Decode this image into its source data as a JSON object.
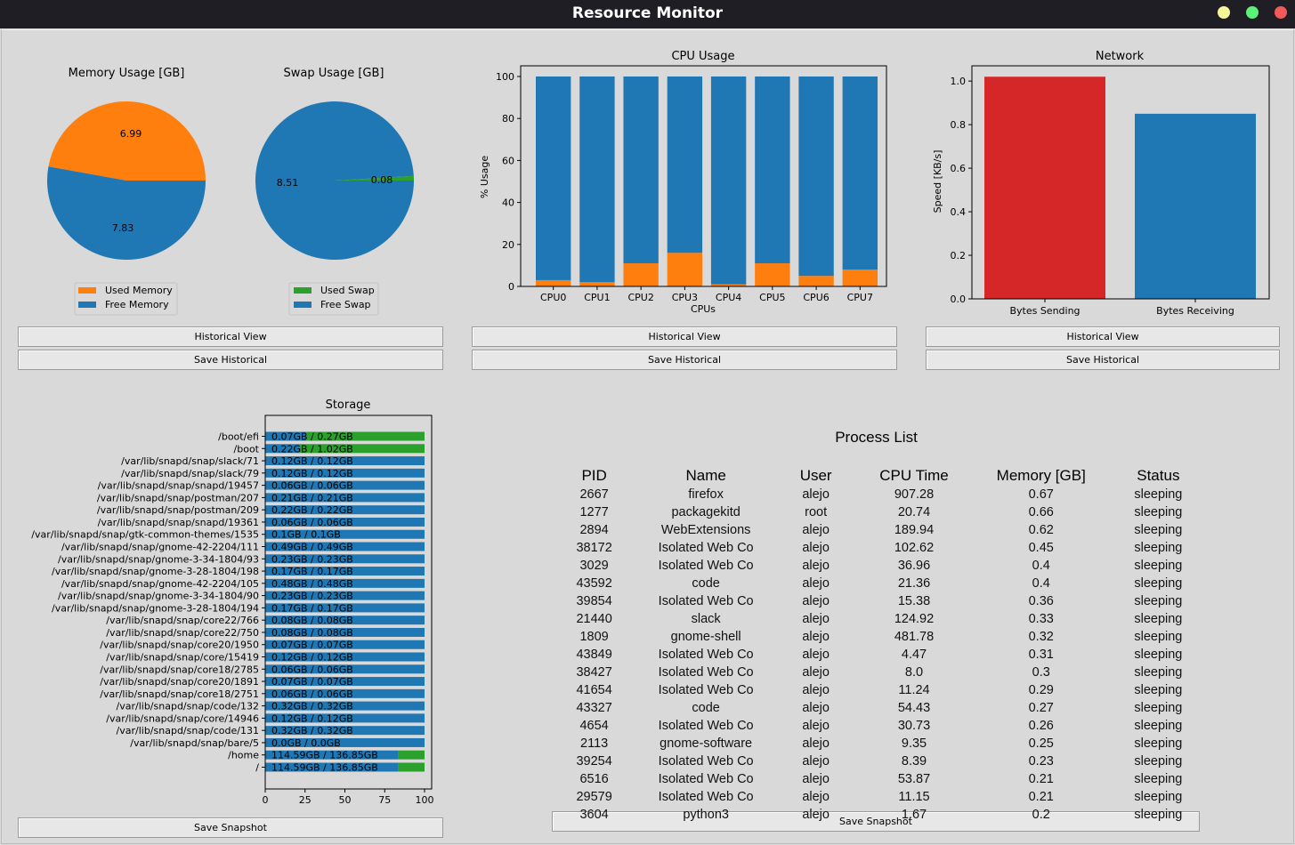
{
  "window": {
    "title": "Resource Monitor"
  },
  "memory": {
    "title": "Memory Usage [GB]",
    "used": 6.99,
    "free": 7.83,
    "used_label": "6.99",
    "free_label": "7.83",
    "legend_used": "Used Memory",
    "legend_free": "Free Memory"
  },
  "swap": {
    "title": "Swap Usage [GB]",
    "used": 0.08,
    "free": 8.51,
    "used_label": "0.08",
    "free_label": "8.51",
    "legend_used": "Used Swap",
    "legend_free": "Free Swap"
  },
  "colors": {
    "used": "#ff7f0e",
    "free": "#1f77b4",
    "swap_used": "#2ca02c",
    "sending": "#d62728",
    "receiving": "#1f77b4"
  },
  "chart_data": [
    {
      "type": "bar",
      "title": "CPU Usage",
      "xlabel": "CPUs",
      "ylabel": "% Usage",
      "categories": [
        "CPU0",
        "CPU1",
        "CPU2",
        "CPU3",
        "CPU4",
        "CPU5",
        "CPU6",
        "CPU7"
      ],
      "series": [
        {
          "values": [
            3,
            2,
            11,
            16,
            1,
            11,
            5,
            8
          ]
        },
        {
          "values": [
            97,
            98,
            89,
            84,
            99,
            89,
            95,
            92
          ]
        }
      ],
      "ylim": [
        0,
        100
      ],
      "yticks": [
        "0",
        "20",
        "40",
        "60",
        "80",
        "100"
      ]
    },
    {
      "type": "bar",
      "title": "Network",
      "ylabel": "Speed [KB/s]",
      "categories": [
        "Bytes Sending",
        "Bytes Receiving"
      ],
      "values": [
        1.02,
        0.85
      ],
      "ylim": [
        0,
        1.07
      ],
      "yticks": [
        "0.0",
        "0.2",
        "0.4",
        "0.6",
        "0.8",
        "1.0"
      ]
    },
    {
      "type": "bar",
      "title": "Storage",
      "xlim": [
        0,
        100
      ],
      "xticks": [
        "0",
        "25",
        "50",
        "75",
        "100"
      ],
      "rows": [
        {
          "name": "/boot/efi",
          "used_pct": 25.9,
          "label": "0.07GB / 0.27GB"
        },
        {
          "name": "/boot",
          "used_pct": 21.6,
          "label": "0.22GB / 1.02GB"
        },
        {
          "name": "/var/lib/snapd/snap/slack/71",
          "used_pct": 100,
          "label": "0.12GB / 0.12GB"
        },
        {
          "name": "/var/lib/snapd/snap/slack/79",
          "used_pct": 100,
          "label": "0.12GB / 0.12GB"
        },
        {
          "name": "/var/lib/snapd/snap/snapd/19457",
          "used_pct": 100,
          "label": "0.06GB / 0.06GB"
        },
        {
          "name": "/var/lib/snapd/snap/postman/207",
          "used_pct": 100,
          "label": "0.21GB / 0.21GB"
        },
        {
          "name": "/var/lib/snapd/snap/postman/209",
          "used_pct": 100,
          "label": "0.22GB / 0.22GB"
        },
        {
          "name": "/var/lib/snapd/snap/snapd/19361",
          "used_pct": 100,
          "label": "0.06GB / 0.06GB"
        },
        {
          "name": "/var/lib/snapd/snap/gtk-common-themes/1535",
          "used_pct": 100,
          "label": "0.1GB / 0.1GB"
        },
        {
          "name": "/var/lib/snapd/snap/gnome-42-2204/111",
          "used_pct": 100,
          "label": "0.49GB / 0.49GB"
        },
        {
          "name": "/var/lib/snapd/snap/gnome-3-34-1804/93",
          "used_pct": 100,
          "label": "0.23GB / 0.23GB"
        },
        {
          "name": "/var/lib/snapd/snap/gnome-3-28-1804/198",
          "used_pct": 100,
          "label": "0.17GB / 0.17GB"
        },
        {
          "name": "/var/lib/snapd/snap/gnome-42-2204/105",
          "used_pct": 100,
          "label": "0.48GB / 0.48GB"
        },
        {
          "name": "/var/lib/snapd/snap/gnome-3-34-1804/90",
          "used_pct": 100,
          "label": "0.23GB / 0.23GB"
        },
        {
          "name": "/var/lib/snapd/snap/gnome-3-28-1804/194",
          "used_pct": 100,
          "label": "0.17GB / 0.17GB"
        },
        {
          "name": "/var/lib/snapd/snap/core22/766",
          "used_pct": 100,
          "label": "0.08GB / 0.08GB"
        },
        {
          "name": "/var/lib/snapd/snap/core22/750",
          "used_pct": 100,
          "label": "0.08GB / 0.08GB"
        },
        {
          "name": "/var/lib/snapd/snap/core20/1950",
          "used_pct": 100,
          "label": "0.07GB / 0.07GB"
        },
        {
          "name": "/var/lib/snapd/snap/core/15419",
          "used_pct": 100,
          "label": "0.12GB / 0.12GB"
        },
        {
          "name": "/var/lib/snapd/snap/core18/2785",
          "used_pct": 100,
          "label": "0.06GB / 0.06GB"
        },
        {
          "name": "/var/lib/snapd/snap/core20/1891",
          "used_pct": 100,
          "label": "0.07GB / 0.07GB"
        },
        {
          "name": "/var/lib/snapd/snap/core18/2751",
          "used_pct": 100,
          "label": "0.06GB / 0.06GB"
        },
        {
          "name": "/var/lib/snapd/snap/code/132",
          "used_pct": 100,
          "label": "0.32GB / 0.32GB"
        },
        {
          "name": "/var/lib/snapd/snap/core/14946",
          "used_pct": 100,
          "label": "0.12GB / 0.12GB"
        },
        {
          "name": "/var/lib/snapd/snap/code/131",
          "used_pct": 100,
          "label": "0.32GB / 0.32GB"
        },
        {
          "name": "/var/lib/snapd/snap/bare/5",
          "used_pct": 100,
          "label": "0.0GB / 0.0GB"
        },
        {
          "name": "/home",
          "used_pct": 83.7,
          "label": "114.59GB / 136.85GB"
        },
        {
          "name": "/",
          "used_pct": 83.7,
          "label": "114.59GB / 136.85GB"
        }
      ]
    }
  ],
  "buttons": {
    "memory_historical": "Historical View",
    "memory_save": "Save Historical",
    "cpu_historical": "Historical View",
    "cpu_save": "Save Historical",
    "network_historical": "Historical View",
    "network_save": "Save Historical",
    "storage_snapshot": "Save Snapshot",
    "process_snapshot": "Save Snapshot"
  },
  "process_list": {
    "title": "Process List",
    "columns": [
      "PID",
      "Name",
      "User",
      "CPU Time",
      "Memory [GB]",
      "Status"
    ],
    "rows": [
      [
        "2667",
        "firefox",
        "alejo",
        "907.28",
        "0.67",
        "sleeping"
      ],
      [
        "1277",
        "packagekitd",
        "root",
        "20.74",
        "0.66",
        "sleeping"
      ],
      [
        "2894",
        "WebExtensions",
        "alejo",
        "189.94",
        "0.62",
        "sleeping"
      ],
      [
        "38172",
        "Isolated Web Co",
        "alejo",
        "102.62",
        "0.45",
        "sleeping"
      ],
      [
        "3029",
        "Isolated Web Co",
        "alejo",
        "36.96",
        "0.4",
        "sleeping"
      ],
      [
        "43592",
        "code",
        "alejo",
        "21.36",
        "0.4",
        "sleeping"
      ],
      [
        "39854",
        "Isolated Web Co",
        "alejo",
        "15.38",
        "0.36",
        "sleeping"
      ],
      [
        "21440",
        "slack",
        "alejo",
        "124.92",
        "0.33",
        "sleeping"
      ],
      [
        "1809",
        "gnome-shell",
        "alejo",
        "481.78",
        "0.32",
        "sleeping"
      ],
      [
        "43849",
        "Isolated Web Co",
        "alejo",
        "4.47",
        "0.31",
        "sleeping"
      ],
      [
        "38427",
        "Isolated Web Co",
        "alejo",
        "8.0",
        "0.3",
        "sleeping"
      ],
      [
        "41654",
        "Isolated Web Co",
        "alejo",
        "11.24",
        "0.29",
        "sleeping"
      ],
      [
        "43327",
        "code",
        "alejo",
        "54.43",
        "0.27",
        "sleeping"
      ],
      [
        "4654",
        "Isolated Web Co",
        "alejo",
        "30.73",
        "0.26",
        "sleeping"
      ],
      [
        "2113",
        "gnome-software",
        "alejo",
        "9.35",
        "0.25",
        "sleeping"
      ],
      [
        "39254",
        "Isolated Web Co",
        "alejo",
        "8.39",
        "0.23",
        "sleeping"
      ],
      [
        "6516",
        "Isolated Web Co",
        "alejo",
        "53.87",
        "0.21",
        "sleeping"
      ],
      [
        "29579",
        "Isolated Web Co",
        "alejo",
        "11.15",
        "0.21",
        "sleeping"
      ],
      [
        "3604",
        "python3",
        "alejo",
        "1.67",
        "0.2",
        "sleeping"
      ]
    ]
  }
}
